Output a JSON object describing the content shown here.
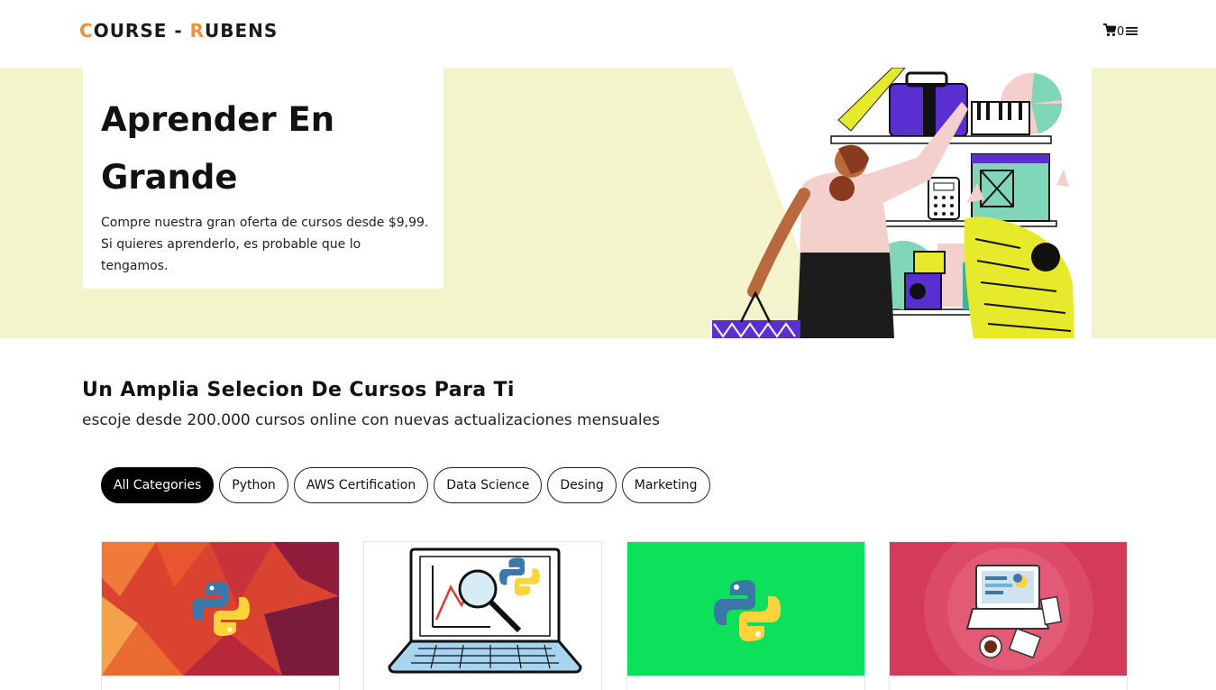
{
  "header": {
    "logo_c": "C",
    "logo_rest1": "OURSE - ",
    "logo_r": "R",
    "logo_rest2": "UBENS",
    "cart_count": "0",
    "accent_color": "#f0903a"
  },
  "hero": {
    "title": "Aprender En Grande",
    "text": "Compre nuestra gran oferta de cursos desde $9,99. Si quieres aprenderlo, es probable que lo tengamos.",
    "background_color": "#f3f3cc"
  },
  "section": {
    "title": "Un Amplia Selecion De Cursos Para Ti",
    "subtitle": "escoje desde 200.000 cursos online con nuevas actualizaciones mensuales"
  },
  "categories": [
    {
      "label": "All Categories",
      "active": true
    },
    {
      "label": "Python",
      "active": false
    },
    {
      "label": "AWS Certification",
      "active": false
    },
    {
      "label": "Data Science",
      "active": false
    },
    {
      "label": "Desing",
      "active": false
    },
    {
      "label": "Marketing",
      "active": false
    }
  ],
  "courses": [
    {
      "thumb_icon": "python-logo-on-red-mosaic",
      "bg": "#d9432f"
    },
    {
      "thumb_icon": "laptop-with-chart-and-python-logo",
      "bg": "#ffffff"
    },
    {
      "thumb_icon": "python-logo-on-green",
      "bg": "#0de15c"
    },
    {
      "thumb_icon": "laptop-and-coffee-on-pink",
      "bg": "#d33a5c"
    }
  ],
  "icons": {
    "cart": "cart-icon",
    "menu": "menu-icon"
  }
}
